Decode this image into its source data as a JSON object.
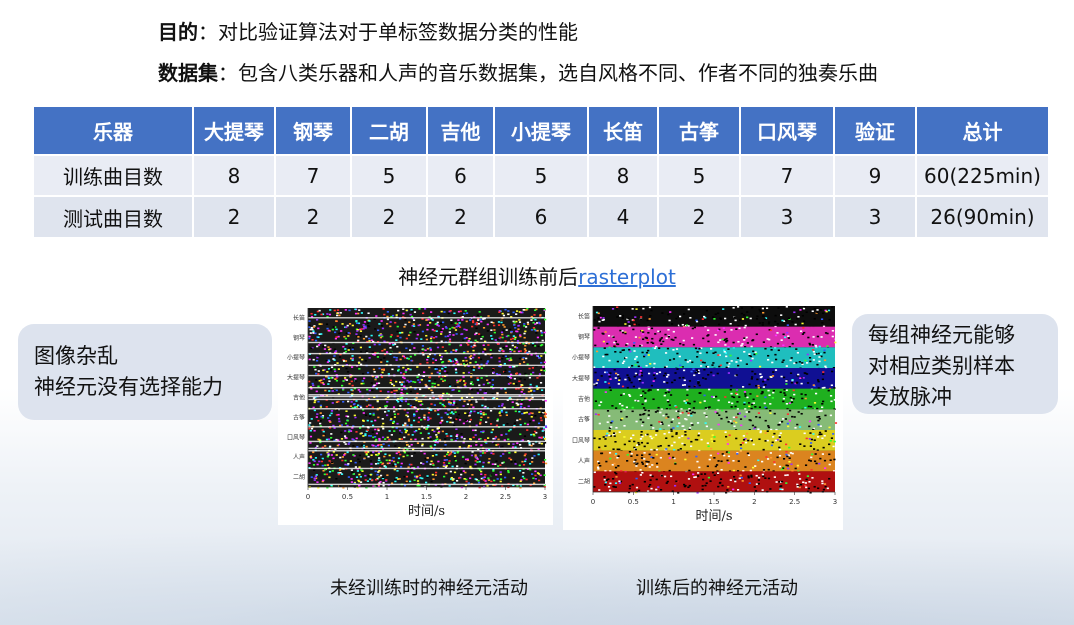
{
  "intro": {
    "goal_label": "目的",
    "goal_text": "：对比验证算法对于单标签数据分类的性能",
    "dataset_label": "数据集",
    "dataset_text": "：包含八类乐器和人声的音乐数据集，选自风格不同、作者不同的独奏乐曲"
  },
  "table": {
    "headers": [
      "乐器",
      "大提琴",
      "钢琴",
      "二胡",
      "吉他",
      "小提琴",
      "长笛",
      "古筝",
      "口风琴",
      "验证",
      "总计"
    ],
    "rows": [
      [
        "训练曲目数",
        "8",
        "7",
        "5",
        "6",
        "5",
        "8",
        "5",
        "7",
        "9",
        "60(225min)"
      ],
      [
        "测试曲目数",
        "2",
        "2",
        "2",
        "2",
        "6",
        "4",
        "2",
        "3",
        "3",
        "26(90min)"
      ]
    ]
  },
  "caption": {
    "text": "神经元群组训练前后",
    "link": "rasterplot"
  },
  "bubble_left": {
    "line1": "图像杂乱",
    "line2": "神经元没有选择能力"
  },
  "bubble_right": {
    "line1": "每组神经元能够",
    "line2": "对相应类别样本",
    "line3": "发放脉冲"
  },
  "plot_left": {
    "y_labels": [
      "长笛",
      "钢琴",
      "小提琴",
      "大提琴",
      "吉他",
      "古筝",
      "口风琴",
      "人声",
      "二胡"
    ],
    "x_ticks": [
      "0",
      "0.5",
      "1",
      "1.5",
      "2",
      "2.5",
      "3"
    ],
    "x_label": "时间/s",
    "caption": "未经训练时的神经元活动"
  },
  "plot_right": {
    "y_labels": [
      "长笛",
      "钢琴",
      "小提琴",
      "大提琴",
      "吉他",
      "古筝",
      "口风琴",
      "人声",
      "二胡"
    ],
    "x_ticks": [
      "0",
      "0.5",
      "1",
      "1.5",
      "2",
      "2.5",
      "3"
    ],
    "x_label": "时间/s",
    "caption": "训练后的神经元活动",
    "band_colors": [
      "#0d0d0d",
      "#ff33cc",
      "#22dddd",
      "#1111aa",
      "#22cc22",
      "#9bd98a",
      "#ffee22",
      "#ff9922",
      "#cc1111"
    ]
  }
}
